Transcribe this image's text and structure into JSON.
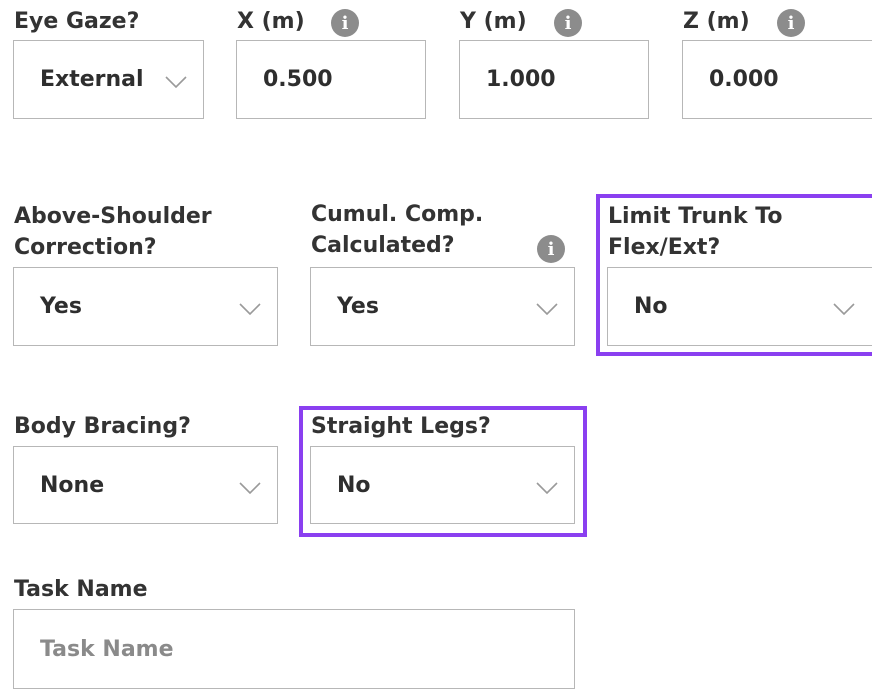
{
  "eye_gaze": {
    "label": "Eye Gaze?",
    "value": "External"
  },
  "x": {
    "label": "X (m)",
    "value": "0.500",
    "info_icon": "i"
  },
  "y": {
    "label": "Y (m)",
    "value": "1.000",
    "info_icon": "i"
  },
  "z": {
    "label": "Z (m)",
    "value": "0.000",
    "info_icon": "i"
  },
  "above_shoulder": {
    "label_line1": "Above-Shoulder",
    "label_line2": "Correction?",
    "value": "Yes"
  },
  "cumul_comp": {
    "label_line1": "Cumul. Comp.",
    "label_line2": "Calculated?",
    "value": "Yes",
    "info_icon": "i"
  },
  "limit_trunk": {
    "label_line1": "Limit Trunk To",
    "label_line2": "Flex/Ext?",
    "value": "No"
  },
  "body_bracing": {
    "label": "Body Bracing?",
    "value": "None"
  },
  "straight_legs": {
    "label": "Straight Legs?",
    "value": "No"
  },
  "task_name": {
    "label": "Task Name",
    "placeholder": "Task Name"
  },
  "colors": {
    "highlight": "#8a3ff0",
    "info_icon": "#8c8c8c",
    "border": "#b7b7b7"
  }
}
